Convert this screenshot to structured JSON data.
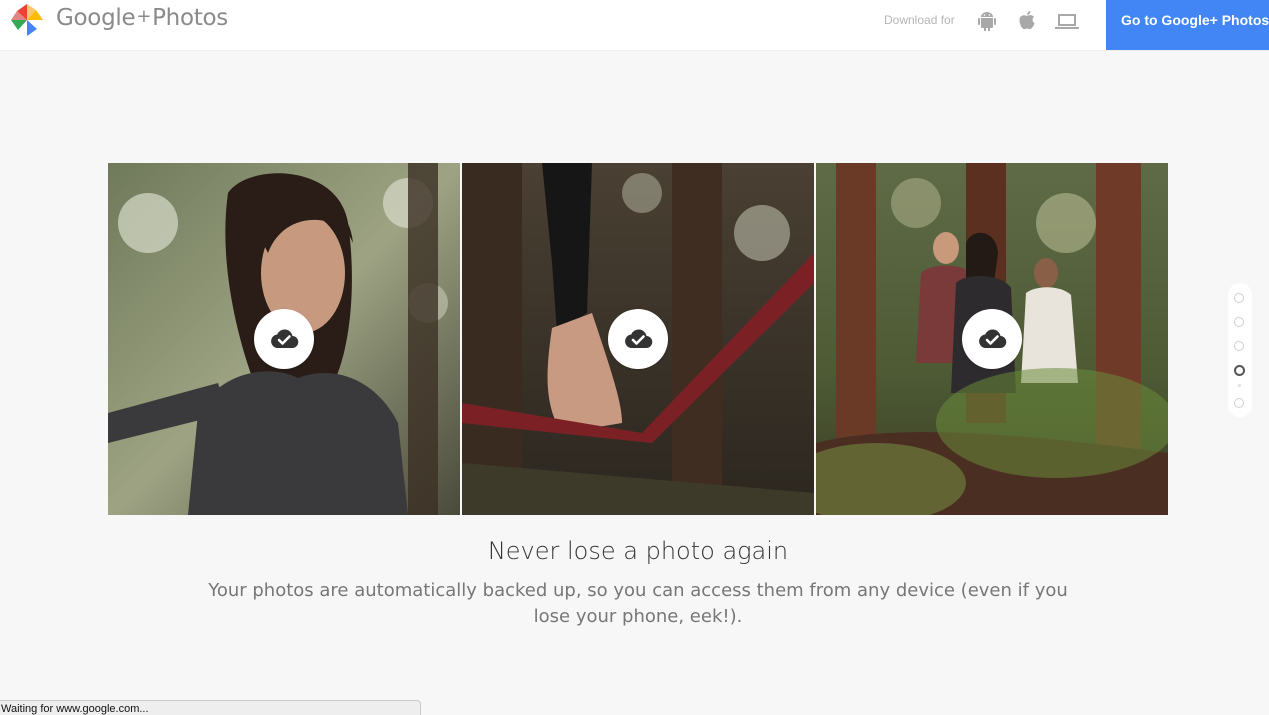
{
  "header": {
    "brand_google": "Google",
    "brand_plus": "+",
    "brand_photos": "Photos",
    "download_label": "Download for",
    "download_icons": [
      "android-icon",
      "apple-icon",
      "laptop-icon"
    ],
    "cta_label": "Go to Google+ Photos"
  },
  "hero": {
    "headline": "Never lose a photo again",
    "description": "Your photos are automatically backed up, so you can access them from any device (even if you lose your phone, eek!)."
  },
  "photos": [
    {
      "badge_icon": "cloud-check-icon"
    },
    {
      "badge_icon": "cloud-check-icon"
    },
    {
      "badge_icon": "cloud-check-icon"
    }
  ],
  "pager": {
    "count": 5,
    "active_index": 3
  },
  "statusbar": {
    "text": "Waiting for www.google.com..."
  },
  "colors": {
    "accent": "#4285f4",
    "background": "#f7f7f7"
  }
}
